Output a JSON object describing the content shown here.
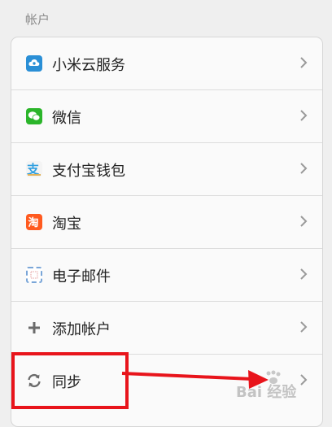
{
  "section": {
    "title": "帐户"
  },
  "accounts": [
    {
      "label": "小米云服务",
      "icon": "mi-cloud-icon",
      "color": "#2a8fd6"
    },
    {
      "label": "微信",
      "icon": "wechat-icon",
      "color": "#2bb52a"
    },
    {
      "label": "支付宝钱包",
      "icon": "alipay-icon",
      "color": "#2f9fe0"
    },
    {
      "label": "淘宝",
      "icon": "taobao-icon",
      "color": "#ff5a1f"
    },
    {
      "label": "电子邮件",
      "icon": "email-icon",
      "color": "#7aa6d8"
    },
    {
      "label": "添加帐户",
      "icon": "plus-icon",
      "color": "#6a6a6a"
    },
    {
      "label": "同步",
      "icon": "sync-icon",
      "color": "#6a6a6a"
    }
  ],
  "watermark": {
    "text": "Bai 经验"
  },
  "annotation": {
    "color": "#e8141b"
  }
}
